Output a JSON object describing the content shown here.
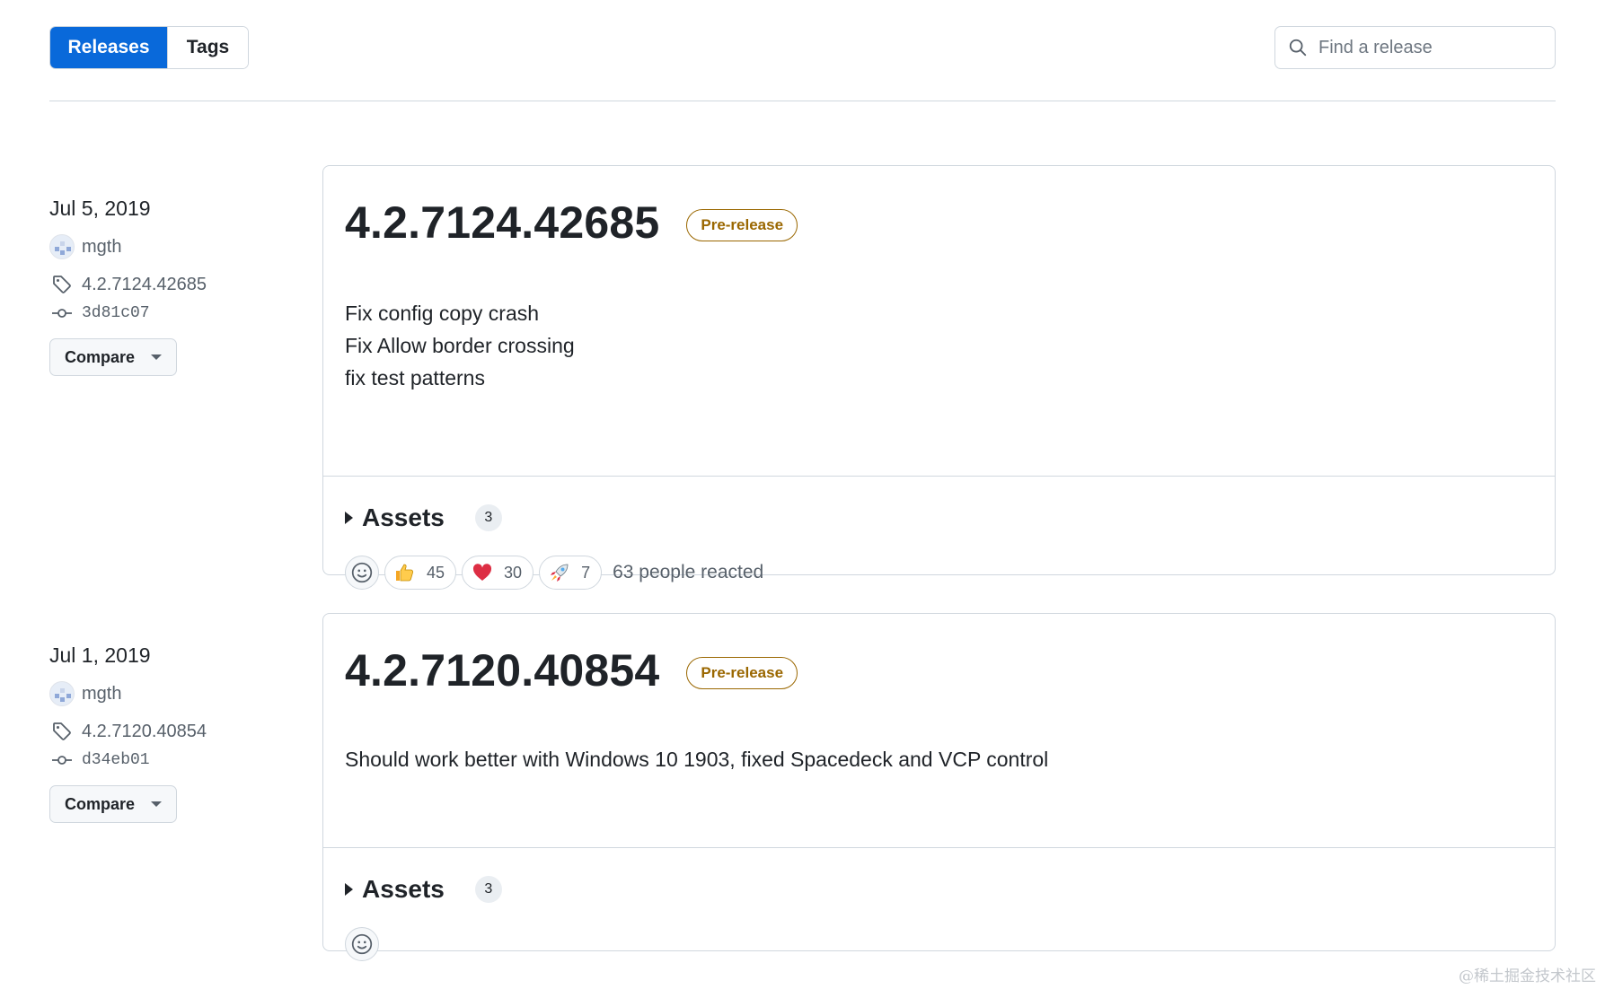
{
  "tabs": {
    "releases": "Releases",
    "tags": "Tags"
  },
  "search": {
    "placeholder": "Find a release"
  },
  "releases": [
    {
      "date": "Jul 5, 2019",
      "author": "mgth",
      "tag": "4.2.7124.42685",
      "commit": "3d81c07",
      "compare_label": "Compare",
      "version": "4.2.7124.42685",
      "badge": "Pre-release",
      "notes": [
        "Fix config copy crash",
        "Fix Allow border crossing",
        "fix test patterns"
      ],
      "assets_label": "Assets",
      "assets_count": "3",
      "reactions": [
        {
          "icon": "thumbs-up-icon",
          "count": "45"
        },
        {
          "icon": "heart-icon",
          "count": "30"
        },
        {
          "icon": "rocket-icon",
          "count": "7"
        }
      ],
      "reacted_text": "63 people reacted"
    },
    {
      "date": "Jul 1, 2019",
      "author": "mgth",
      "tag": "4.2.7120.40854",
      "commit": "d34eb01",
      "compare_label": "Compare",
      "version": "4.2.7120.40854",
      "badge": "Pre-release",
      "notes": [
        "Should work better with Windows 10 1903, fixed Spacedeck and VCP control"
      ],
      "assets_label": "Assets",
      "assets_count": "3"
    }
  ],
  "watermark": "@稀土掘金技术社区",
  "colors": {
    "accent": "#0969da",
    "prerelease": "#9a6700",
    "border": "#d0d7de"
  }
}
